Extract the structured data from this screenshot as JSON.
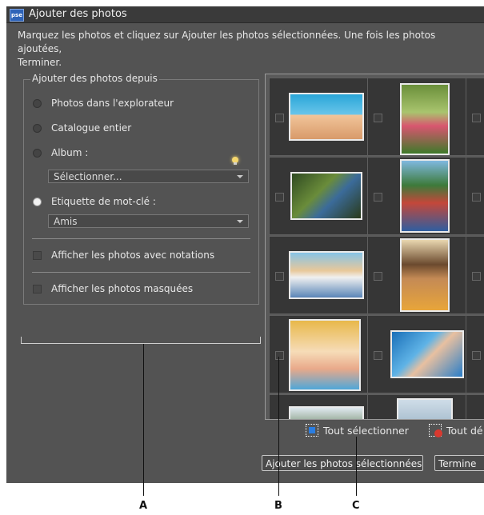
{
  "window": {
    "title": "Ajouter des photos",
    "app_icon": "pse"
  },
  "instruction": "Marquez les photos et cliquez sur Ajouter les photos sélectionnées. Une fois les photos ajoutées,\nTerminer.",
  "source": {
    "legend": "Ajouter des photos depuis",
    "options": [
      {
        "label": "Photos dans l'explorateur"
      },
      {
        "label": "Catalogue entier"
      },
      {
        "label": "Album :"
      },
      {
        "label": "Etiquette de mot-clé :"
      }
    ],
    "album_select": "Sélectionner...",
    "keyword_select": "Amis",
    "checkboxes": [
      {
        "label": "Afficher les photos avec notations"
      },
      {
        "label": "Afficher les photos masquées"
      }
    ]
  },
  "toolbar": {
    "select_all": "Tout sélectionner",
    "deselect_all": "Tout dé"
  },
  "buttons": {
    "add_selected": "Ajouter les photos sélectionnées",
    "finish": "Termine"
  },
  "callouts": {
    "a": "A",
    "b": "B",
    "c": "C"
  }
}
